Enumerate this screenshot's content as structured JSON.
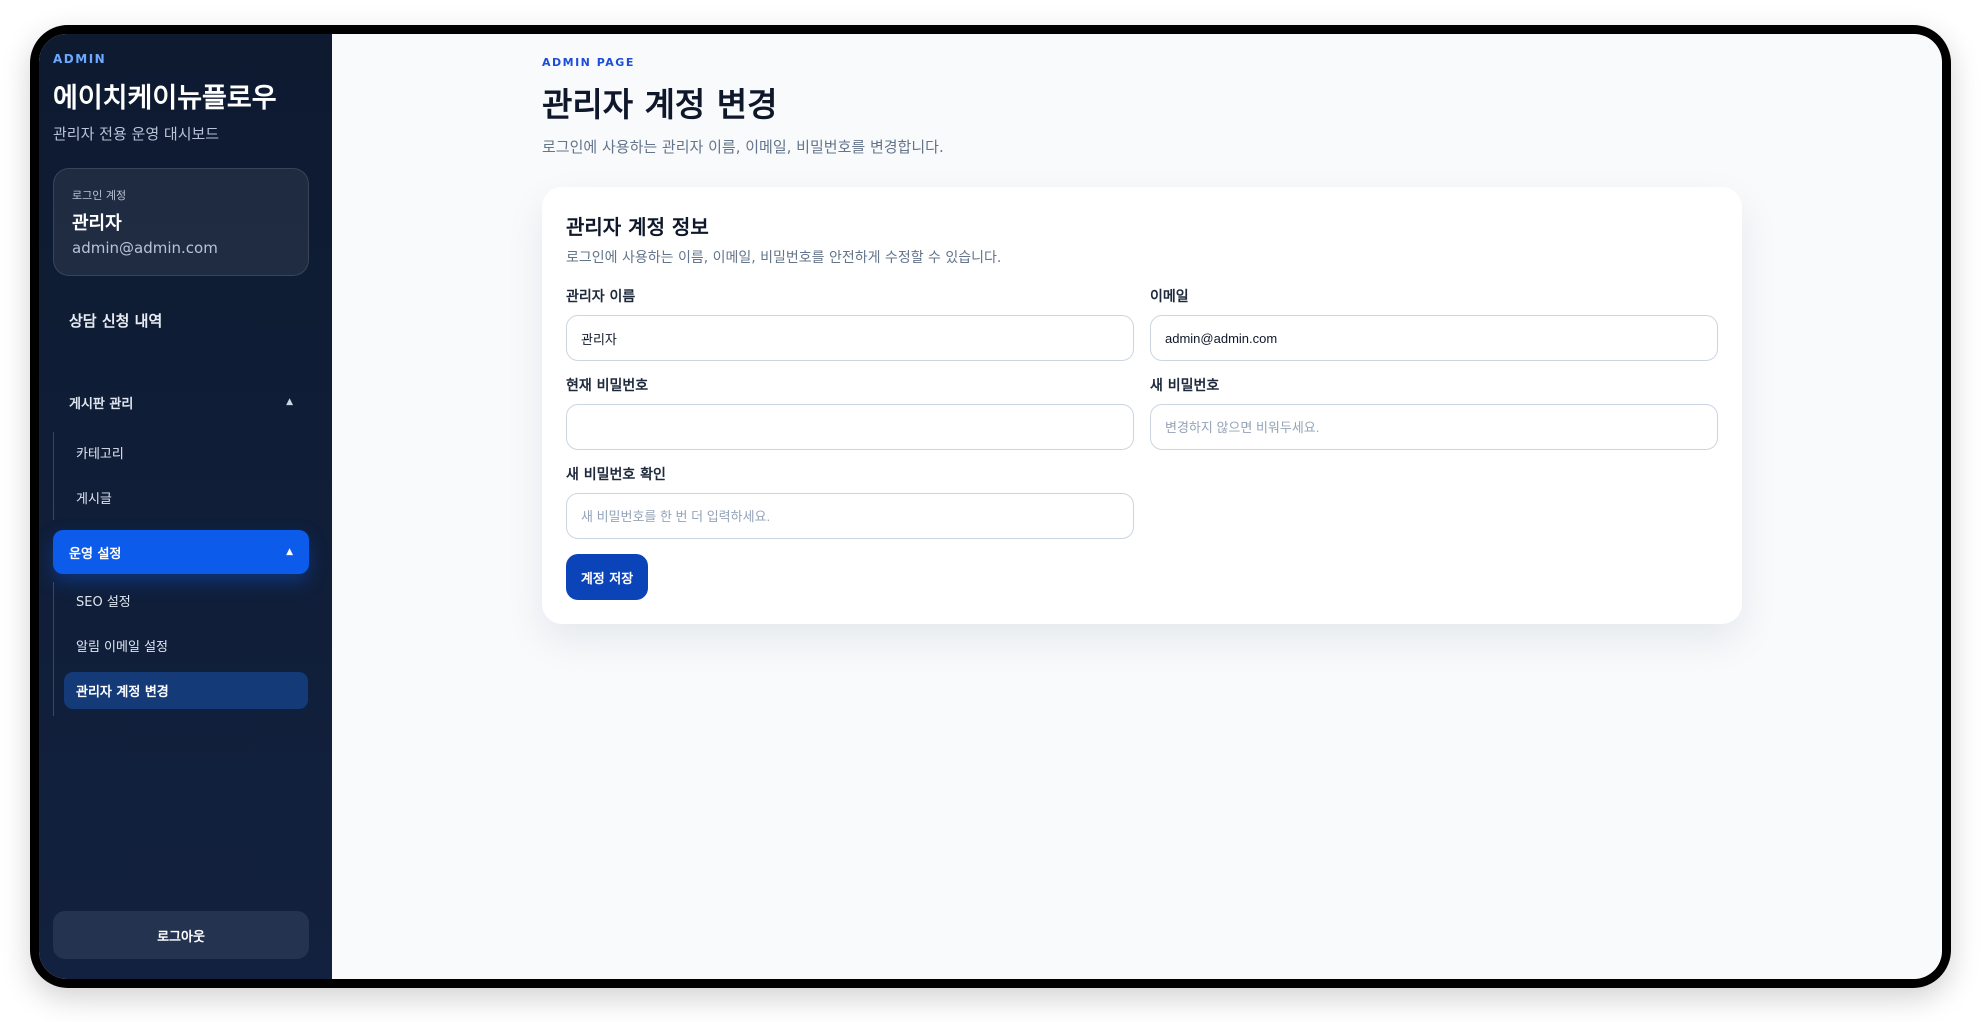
{
  "sidebar": {
    "brand_small": "ADMIN",
    "brand_title": "에이치케이뉴플로우",
    "brand_subtitle": "관리자 전용 운영 대시보드",
    "account": {
      "label": "로그인 계정",
      "name": "관리자",
      "email": "admin@admin.com"
    },
    "nav_top": "상담 신청 내역",
    "groups": [
      {
        "label": "게시판 관리",
        "expanded": true,
        "items": [
          {
            "label": "카테고리"
          },
          {
            "label": "게시글"
          }
        ]
      },
      {
        "label": "운영 설정",
        "expanded": true,
        "active": true,
        "items": [
          {
            "label": "SEO 설정"
          },
          {
            "label": "알림 이메일 설정"
          },
          {
            "label": "관리자 계정 변경",
            "active": true
          }
        ]
      }
    ],
    "logout": "로그아웃"
  },
  "main": {
    "eyebrow": "ADMIN PAGE",
    "title": "관리자 계정 변경",
    "description": "로그인에 사용하는 관리자 이름, 이메일, 비밀번호를 변경합니다.",
    "card": {
      "title": "관리자 계정 정보",
      "description": "로그인에 사용하는 이름, 이메일, 비밀번호를 안전하게 수정할 수 있습니다.",
      "fields": {
        "name": {
          "label": "관리자 이름",
          "value": "관리자",
          "placeholder": ""
        },
        "email": {
          "label": "이메일",
          "value": "admin@admin.com",
          "placeholder": ""
        },
        "current_password": {
          "label": "현재 비밀번호",
          "value": "",
          "placeholder": ""
        },
        "new_password": {
          "label": "새 비밀번호",
          "value": "",
          "placeholder": "변경하지 않으면 비워두세요."
        },
        "confirm_password": {
          "label": "새 비밀번호 확인",
          "value": "",
          "placeholder": "새 비밀번호를 한 번 더 입력하세요."
        }
      },
      "save_label": "계정 저장"
    }
  },
  "colors": {
    "sidebar_bg": "#0d1a30",
    "accent": "#0d5bea",
    "active_sub": "#143a78",
    "save_button": "#0b43b8",
    "eyebrow": "#1d4ed8"
  }
}
